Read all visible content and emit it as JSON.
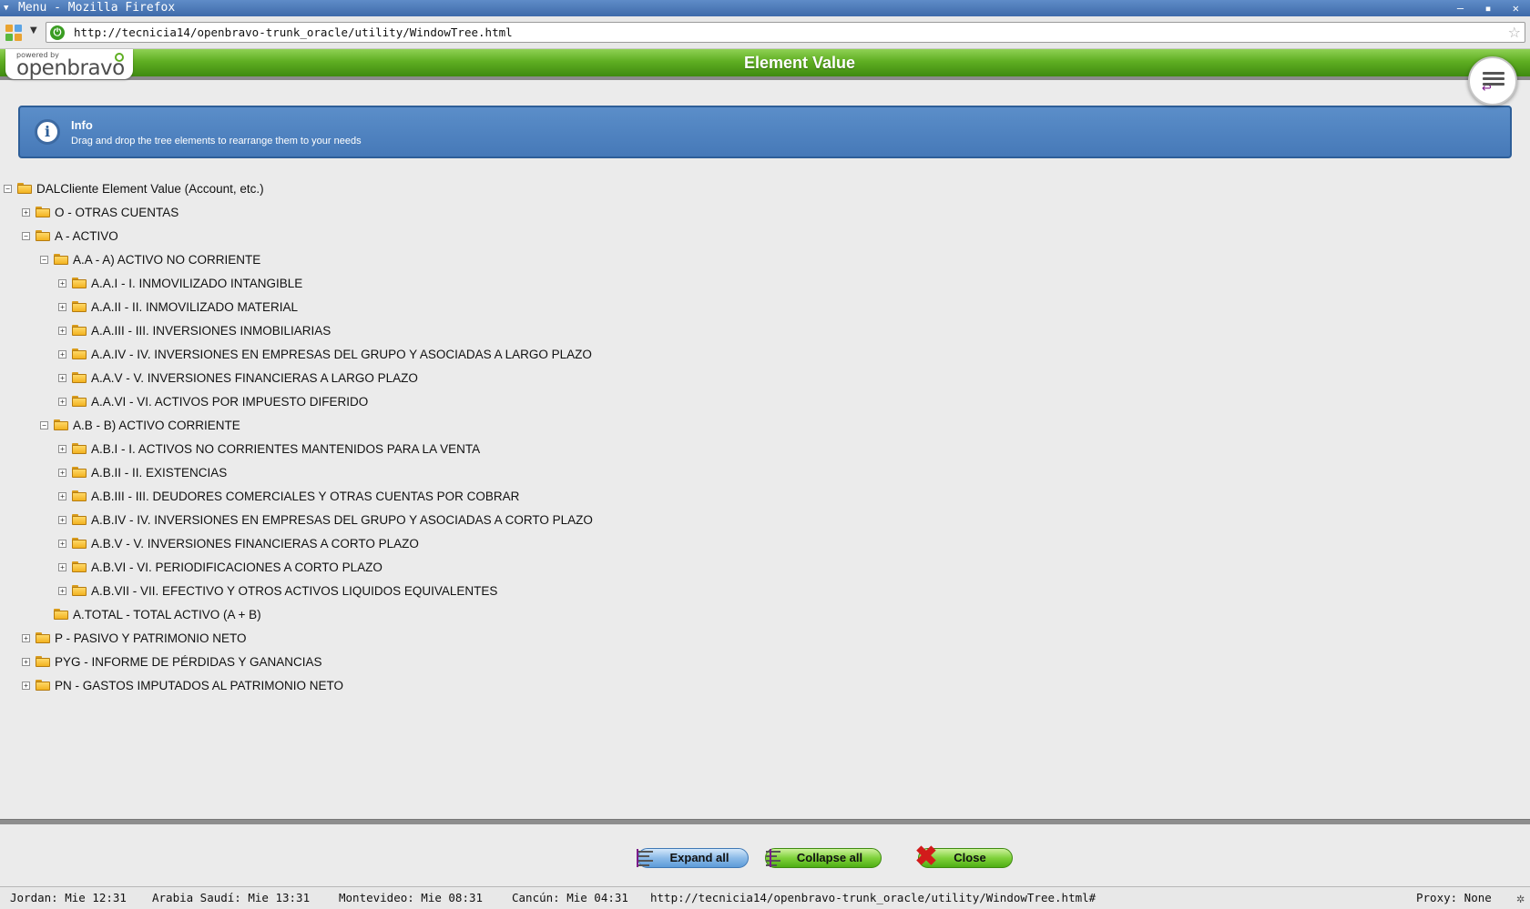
{
  "window": {
    "title": "Menu - Mozilla Firefox",
    "controls": "– ▪ ✕"
  },
  "navbar": {
    "url": "http://tecnicia14/openbravo-trunk_oracle/utility/WindowTree.html",
    "site_icon_glyph": "⏻",
    "star_glyph": "☆"
  },
  "header": {
    "powered_by": "powered by",
    "brand": "openbravo",
    "title": "Element Value"
  },
  "info": {
    "icon_glyph": "i",
    "title": "Info",
    "message": "Drag and drop the tree elements to rearrange them to your needs"
  },
  "tree": {
    "rows": [
      {
        "label": "DALCliente Element Value (Account, etc.)",
        "level": 0,
        "toggle": "−"
      },
      {
        "label": "O - OTRAS CUENTAS",
        "level": 1,
        "toggle": "+"
      },
      {
        "label": "A - ACTIVO",
        "level": 1,
        "toggle": "−"
      },
      {
        "label": "A.A - A) ACTIVO NO CORRIENTE",
        "level": 2,
        "toggle": "−"
      },
      {
        "label": "A.A.I - I. INMOVILIZADO INTANGIBLE",
        "level": 3,
        "toggle": "+"
      },
      {
        "label": "A.A.II - II. INMOVILIZADO MATERIAL",
        "level": 3,
        "toggle": "+"
      },
      {
        "label": "A.A.III - III. INVERSIONES INMOBILIARIAS",
        "level": 3,
        "toggle": "+"
      },
      {
        "label": "A.A.IV - IV. INVERSIONES EN EMPRESAS DEL GRUPO Y ASOCIADAS A LARGO PLAZO",
        "level": 3,
        "toggle": "+"
      },
      {
        "label": "A.A.V - V. INVERSIONES FINANCIERAS A LARGO PLAZO",
        "level": 3,
        "toggle": "+"
      },
      {
        "label": "A.A.VI - VI. ACTIVOS POR IMPUESTO DIFERIDO",
        "level": 3,
        "toggle": "+"
      },
      {
        "label": "A.B - B) ACTIVO CORRIENTE",
        "level": 2,
        "toggle": "−"
      },
      {
        "label": "A.B.I - I. ACTIVOS NO CORRIENTES MANTENIDOS PARA LA VENTA",
        "level": 3,
        "toggle": "+"
      },
      {
        "label": "A.B.II - II. EXISTENCIAS",
        "level": 3,
        "toggle": "+"
      },
      {
        "label": "A.B.III - III. DEUDORES COMERCIALES Y OTRAS CUENTAS POR COBRAR",
        "level": 3,
        "toggle": "+"
      },
      {
        "label": "A.B.IV - IV. INVERSIONES EN EMPRESAS DEL GRUPO Y ASOCIADAS A CORTO PLAZO",
        "level": 3,
        "toggle": "+"
      },
      {
        "label": "A.B.V - V. INVERSIONES FINANCIERAS A CORTO PLAZO",
        "level": 3,
        "toggle": "+"
      },
      {
        "label": "A.B.VI - VI. PERIODIFICACIONES A CORTO PLAZO",
        "level": 3,
        "toggle": "+"
      },
      {
        "label": "A.B.VII - VII. EFECTIVO Y OTROS ACTIVOS LIQUIDOS EQUIVALENTES",
        "level": 3,
        "toggle": "+"
      },
      {
        "label": "A.TOTAL - TOTAL ACTIVO (A + B)",
        "level": 2,
        "toggle": ""
      },
      {
        "label": "P - PASIVO Y PATRIMONIO NETO",
        "level": 1,
        "toggle": "+"
      },
      {
        "label": "PYG - INFORME DE PÉRDIDAS Y GANANCIAS",
        "level": 1,
        "toggle": "+"
      },
      {
        "label": "PN - GASTOS IMPUTADOS AL PATRIMONIO NETO",
        "level": 1,
        "toggle": "+"
      }
    ]
  },
  "buttons": {
    "expand_all": "Expand all",
    "collapse_all": "Collapse all",
    "close": "Close",
    "close_glyph": "✖"
  },
  "statusbar": {
    "clock_jordan": "Jordan: Mie 12:31",
    "clock_arabia": "Arabia Saudí: Mie 13:31",
    "clock_montevideo": "Montevideo: Mie 08:31",
    "clock_cancun": "Cancún: Mie 04:31",
    "link_url": "http://tecnicia14/openbravo-trunk_oracle/utility/WindowTree.html#",
    "proxy": "Proxy: None",
    "gear_glyph": "✲"
  },
  "colors": {
    "header_green": "#5fae22",
    "info_blue": "#4679b8",
    "folder_yellow": "#f2b321"
  }
}
